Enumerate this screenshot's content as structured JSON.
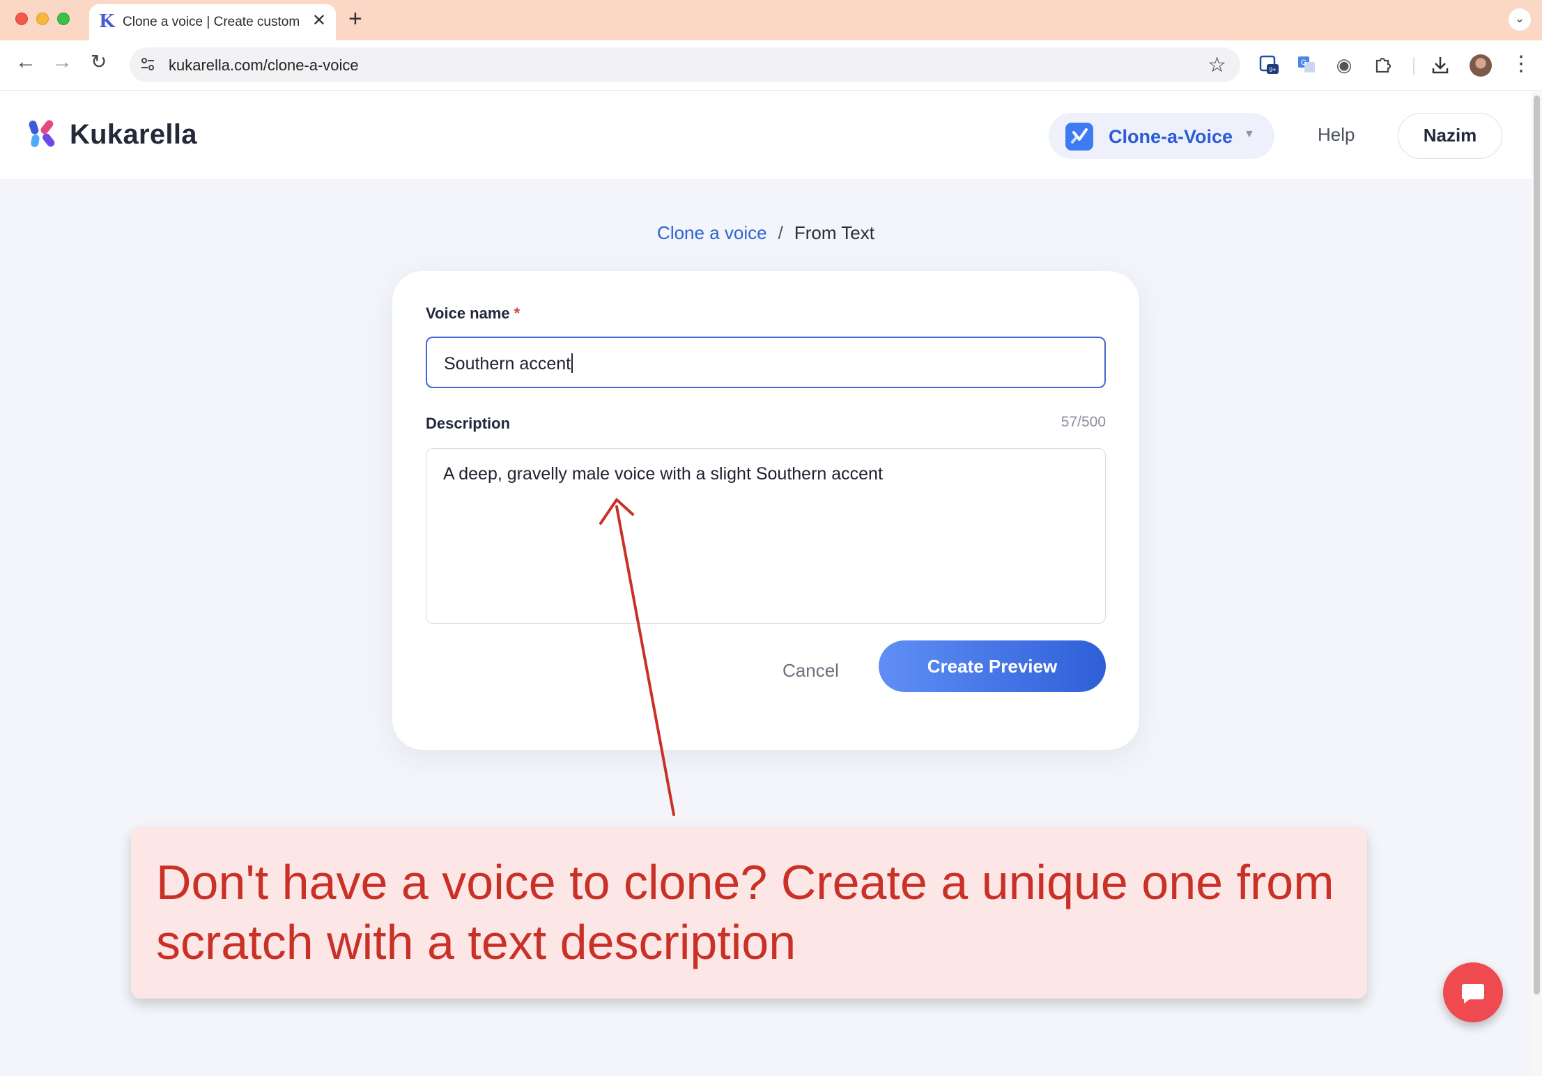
{
  "browser": {
    "tab_title": "Clone a voice | Create custom",
    "tab_favicon": "K",
    "url": "kukarella.com/clone-a-voice",
    "new_tab_symbol": "+",
    "close_tab_symbol": "✕",
    "ext_badge": "9+"
  },
  "header": {
    "logo_text": "Kukarella",
    "product_label": "Clone-a-Voice",
    "help_label": "Help",
    "user_label": "Nazim"
  },
  "breadcrumb": {
    "parent": "Clone a voice",
    "separator": "/",
    "current": "From Text"
  },
  "form": {
    "voice_name_label": "Voice name",
    "required_mark": "*",
    "voice_name_value": "Southern accent",
    "description_label": "Description",
    "description_counter": "57/500",
    "description_value": "A deep, gravelly male voice with a slight Southern accent",
    "cancel_label": "Cancel",
    "create_label": "Create Preview"
  },
  "annotation": {
    "text": "Don't have a voice to clone? Create a unique one from scratch with a text description",
    "color": "#c93127"
  },
  "colors": {
    "accent": "#2f5fd8",
    "brand_blue": "#3d7cf0",
    "chat_button": "#ee4a4f"
  }
}
